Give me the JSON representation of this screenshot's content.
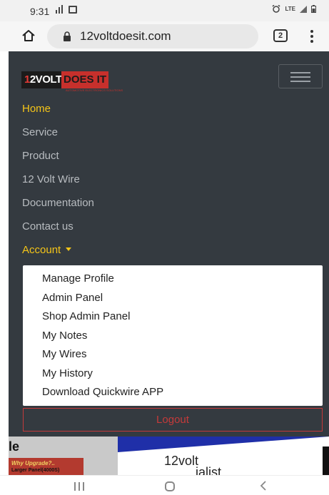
{
  "status_bar": {
    "time": "9:31",
    "right_text": "LTE"
  },
  "browser": {
    "url": "12voltdoesit.com",
    "tab_count": "2"
  },
  "logo": {
    "part1": "12VOLT",
    "part2": "DOES IT",
    "tagline": "AUTOMOTIVE ELECTRONICS SOLUTIONS"
  },
  "nav": {
    "items": [
      {
        "label": "Home",
        "active": true
      },
      {
        "label": "Service",
        "active": false
      },
      {
        "label": "Product",
        "active": false
      },
      {
        "label": "12 Volt Wire",
        "active": false
      },
      {
        "label": "Documentation",
        "active": false
      },
      {
        "label": "Contact us",
        "active": false
      }
    ],
    "account_label": "Account",
    "dropdown": [
      "Manage Profile",
      "Admin Panel",
      "Shop Admin Panel",
      "My Notes",
      "My Wires",
      "My History",
      "Download Quickwire APP"
    ],
    "logout_label": "Logout"
  },
  "page": {
    "promo_title": "le",
    "promo_line1": "Why Upgrade?..",
    "promo_line2": "Larger Panel(4000S)",
    "brand_line1": "12volt",
    "brand_line2": "ialist"
  },
  "colors": {
    "navbar_bg": "#343a40",
    "accent": "#f5c518",
    "logout": "#c43a3a"
  }
}
